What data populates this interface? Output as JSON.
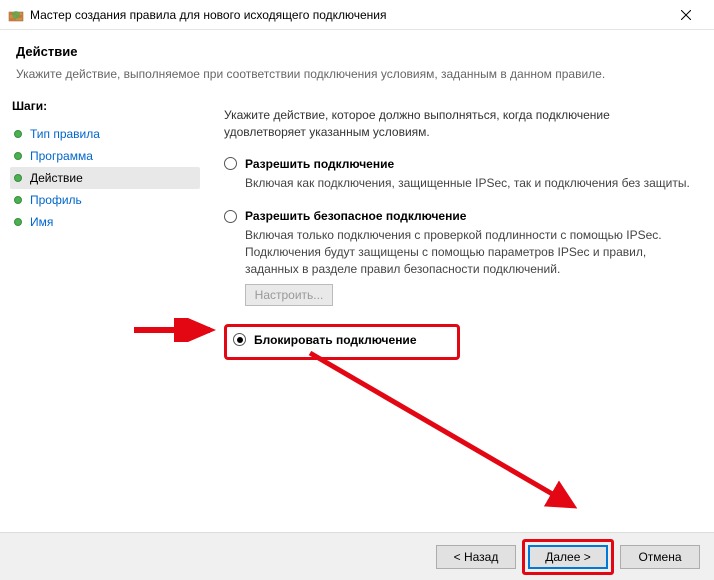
{
  "titlebar": {
    "title": "Мастер создания правила для нового исходящего подключения"
  },
  "header": {
    "title": "Действие",
    "subtitle": "Укажите действие, выполняемое при соответствии подключения условиям, заданным в данном правиле."
  },
  "sidebar": {
    "title": "Шаги:",
    "steps": [
      {
        "label": "Тип правила"
      },
      {
        "label": "Программа"
      },
      {
        "label": "Действие"
      },
      {
        "label": "Профиль"
      },
      {
        "label": "Имя"
      }
    ]
  },
  "main": {
    "intro": "Укажите действие, которое должно выполняться, когда подключение удовлетворяет указанным условиям.",
    "options": [
      {
        "label": "Разрешить подключение",
        "desc": "Включая как подключения, защищенные IPSec, так и подключения без защиты."
      },
      {
        "label": "Разрешить безопасное подключение",
        "desc": "Включая только подключения с проверкой подлинности с помощью IPSec. Подключения будут защищены с помощью параметров IPSec и правил, заданных в разделе правил безопасности подключений."
      },
      {
        "label": "Блокировать подключение"
      }
    ],
    "configure_label": "Настроить..."
  },
  "footer": {
    "back": "< Назад",
    "next": "Далее >",
    "cancel": "Отмена"
  }
}
